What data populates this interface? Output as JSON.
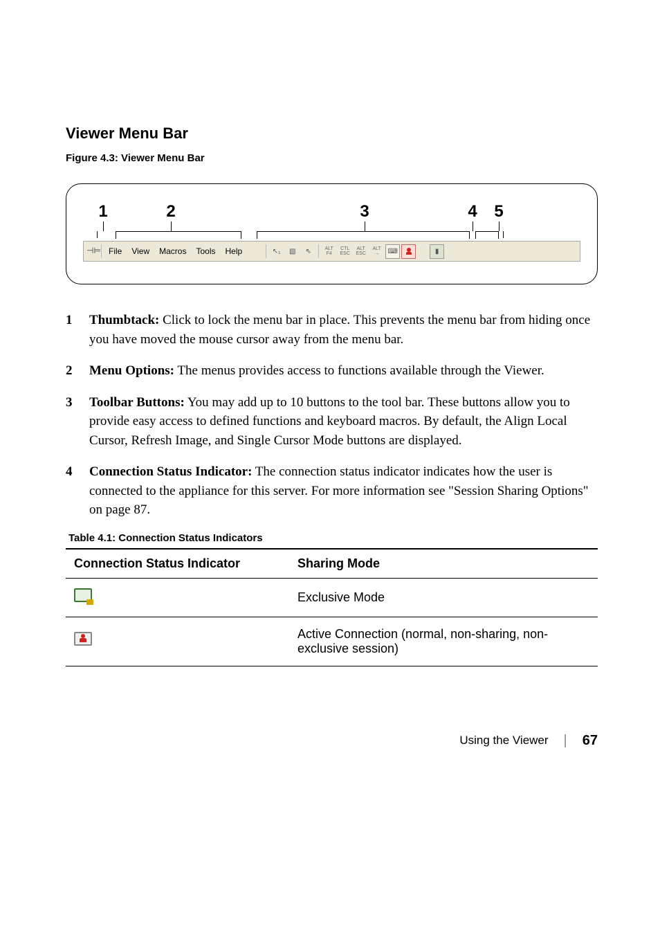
{
  "heading": "Viewer Menu Bar",
  "figure_caption": "Figure 4.3: Viewer Menu Bar",
  "callouts": {
    "c1": "1",
    "c2": "2",
    "c3": "3",
    "c4": "4",
    "c5": "5"
  },
  "menubar": {
    "items": {
      "file": "File",
      "view": "View",
      "macros": "Macros",
      "tools": "Tools",
      "help": "Help"
    },
    "icons": {
      "alt_f4": "ALT\nF4",
      "ctl_esc": "CTL\nESC",
      "alt_esc": "ALT\nESC",
      "alt_arr": "ALT\n→"
    }
  },
  "list": {
    "i1": {
      "num": "1",
      "lead": "Thumbtack:",
      "text": " Click to lock the menu bar in place. This prevents the menu bar from hiding once you have moved the mouse cursor away from the menu bar."
    },
    "i2": {
      "num": "2",
      "lead": "Menu Options:",
      "text": " The menus provides access to functions available through the Viewer."
    },
    "i3": {
      "num": "3",
      "lead": "Toolbar Buttons:",
      "text": " You may add up to 10 buttons to the tool bar. These buttons allow you to provide easy access to defined functions and keyboard macros. By default, the Align Local Cursor, Refresh Image, and Single Cursor Mode buttons are displayed."
    },
    "i4": {
      "num": "4",
      "lead": "Connection Status Indicator:",
      "text": " The connection status indicator indicates how the user is connected to the appliance for this server. For more information see \"Session Sharing Options\" on page 87."
    }
  },
  "table": {
    "caption": "Table 4.1: Connection Status Indicators",
    "h1": "Connection Status Indicator",
    "h2": "Sharing Mode",
    "r1": "Exclusive Mode",
    "r2": "Active Connection (normal, non-sharing, non-exclusive session)"
  },
  "footer": {
    "label": "Using the Viewer",
    "page": "67"
  },
  "chart_data": {
    "type": "table",
    "title": "Table 4.1: Connection Status Indicators",
    "columns": [
      "Connection Status Indicator",
      "Sharing Mode"
    ],
    "rows": [
      [
        "(monitor with lock icon)",
        "Exclusive Mode"
      ],
      [
        "(monitor with red person icon)",
        "Active Connection (normal, non-sharing, non-exclusive session)"
      ]
    ]
  }
}
